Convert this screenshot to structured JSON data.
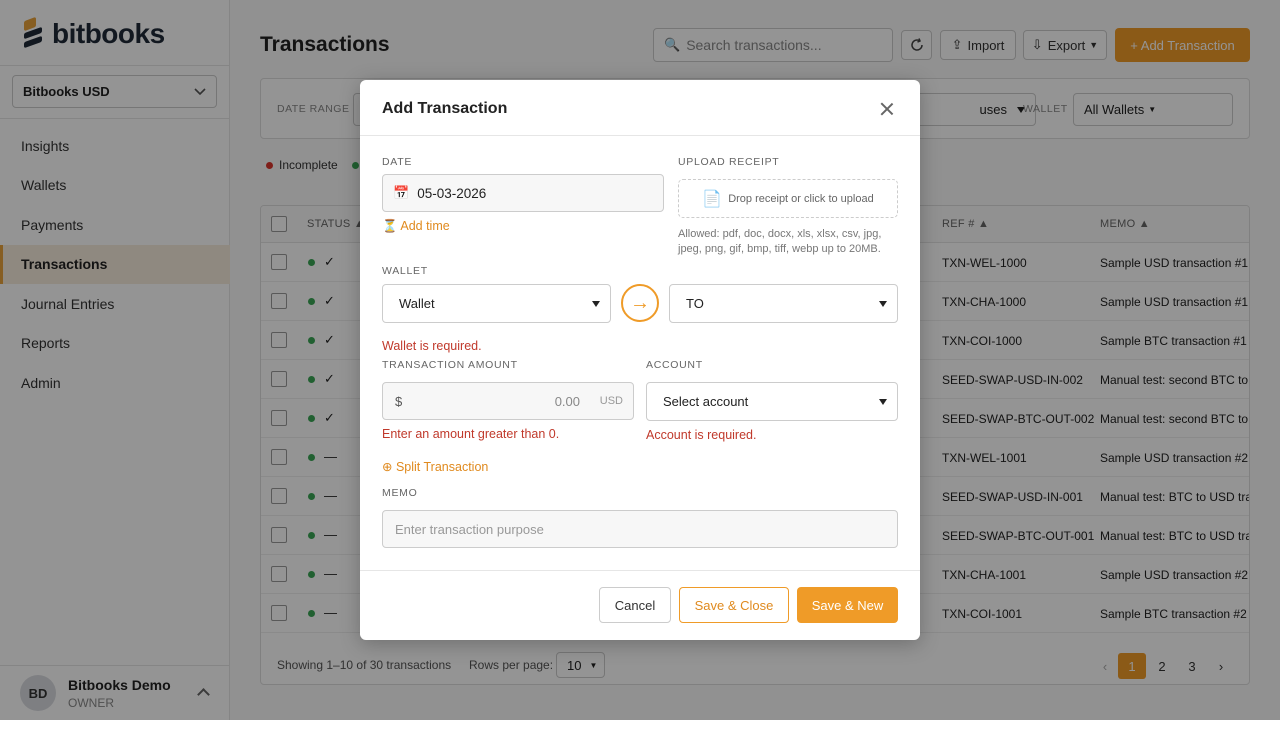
{
  "brand": {
    "name": "bitbooks"
  },
  "org": {
    "selected": "Bitbooks USD"
  },
  "nav": {
    "items": [
      {
        "label": "Insights"
      },
      {
        "label": "Wallets"
      },
      {
        "label": "Payments"
      },
      {
        "label": "Transactions",
        "active": true
      },
      {
        "label": "Journal Entries"
      },
      {
        "label": "Reports"
      },
      {
        "label": "Admin"
      }
    ]
  },
  "user": {
    "initials": "BD",
    "name": "Bitbooks Demo",
    "role": "OWNER"
  },
  "page": {
    "title": "Transactions"
  },
  "toolbar": {
    "search_placeholder": "Search transactions...",
    "import_label": "Import",
    "export_label": "Export",
    "add_label": "+ Add Transaction"
  },
  "filters": {
    "date_range_label": "DATE RANGE",
    "status_value": "uses",
    "wallet_label": "WALLET",
    "wallet_value": "All Wallets"
  },
  "legend": {
    "incomplete": "Incomplete"
  },
  "table": {
    "headers": {
      "status": "STATUS ▲",
      "ref": "REF # ▲",
      "memo": "MEMO ▲"
    },
    "rows": [
      {
        "status": "✓",
        "ref": "TXN-WEL-1000",
        "memo": "Sample USD transaction #1"
      },
      {
        "status": "✓",
        "ref": "TXN-CHA-1000",
        "memo": "Sample USD transaction #1"
      },
      {
        "status": "✓",
        "ref": "TXN-COI-1000",
        "memo": "Sample BTC transaction #1"
      },
      {
        "status": "✓",
        "ref": "SEED-SWAP-USD-IN-002",
        "memo": "Manual test: second BTC to"
      },
      {
        "status": "✓",
        "ref": "SEED-SWAP-BTC-OUT-002",
        "memo": "Manual test: second BTC to"
      },
      {
        "status": "—",
        "ref": "TXN-WEL-1001",
        "memo": "Sample USD transaction #2"
      },
      {
        "status": "—",
        "ref": "SEED-SWAP-USD-IN-001",
        "memo": "Manual test: BTC to USD tra"
      },
      {
        "status": "—",
        "ref": "SEED-SWAP-BTC-OUT-001",
        "memo": "Manual test: BTC to USD tra"
      },
      {
        "status": "—",
        "ref": "TXN-CHA-1001",
        "memo": "Sample USD transaction #2"
      },
      {
        "status": "—",
        "ref": "TXN-COI-1001",
        "memo": "Sample BTC transaction #2"
      }
    ],
    "footer": {
      "showing": "Showing 1–10 of 30 transactions",
      "rows_per_page_label": "Rows per page:",
      "rows_per_page": "10",
      "pages": [
        "1",
        "2",
        "3"
      ],
      "prev": "‹",
      "next": "›"
    }
  },
  "modal": {
    "title": "Add Transaction",
    "date": {
      "label": "DATE",
      "value": "05-03-2026",
      "add_time": "Add time"
    },
    "upload": {
      "label": "UPLOAD RECEIPT",
      "drop_text": "Drop receipt or click to upload",
      "hint": "Allowed: pdf, doc, docx, xls, xlsx, csv, jpg, jpeg, png, gif, bmp, tiff, webp up to 20MB."
    },
    "wallet": {
      "label": "WALLET",
      "from_value": "Wallet",
      "to_value": "TO",
      "error": "Wallet is required."
    },
    "amount": {
      "label": "TRANSACTION AMOUNT",
      "prefix": "$",
      "placeholder": "0.00",
      "currency": "USD",
      "error": "Enter an amount greater than 0."
    },
    "account": {
      "label": "ACCOUNT",
      "value": "Select account",
      "error": "Account is required."
    },
    "split_label": "⊕ Split Transaction",
    "memo": {
      "label": "MEMO",
      "placeholder": "Enter transaction purpose"
    },
    "buttons": {
      "cancel": "Cancel",
      "save_close": "Save & Close",
      "save_new": "Save & New"
    }
  },
  "colors": {
    "accent": "#ef9b28",
    "error": "#c0392b",
    "complete": "#3aa655",
    "incomplete": "#d9342b"
  }
}
